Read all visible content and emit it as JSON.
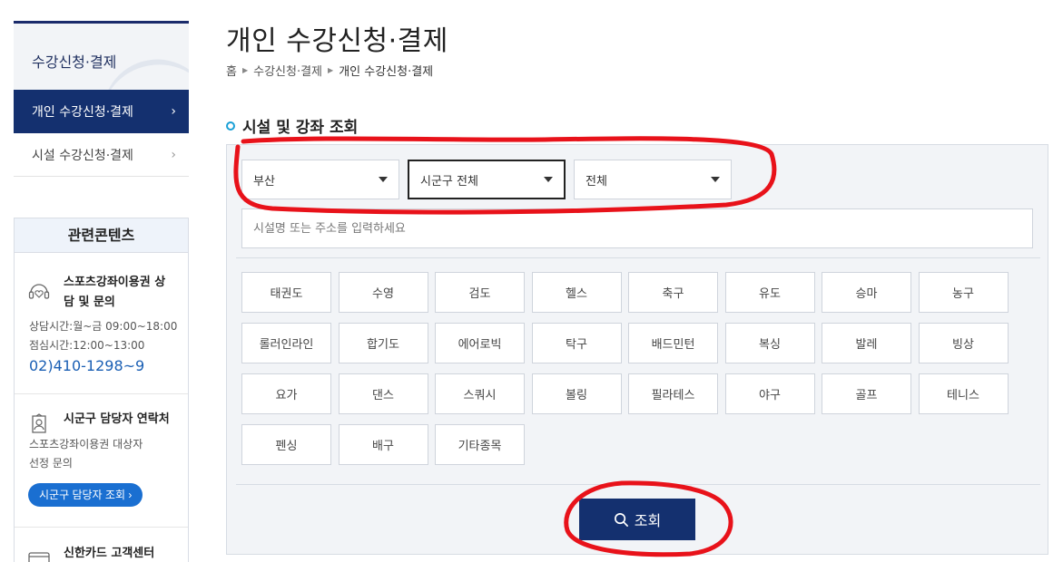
{
  "sidebar": {
    "title": "수강신청·결제",
    "items": [
      {
        "label": "개인 수강신청·결제",
        "active": true
      },
      {
        "label": "시설 수강신청·결제",
        "active": false
      }
    ]
  },
  "related": {
    "heading": "관련콘텐츠",
    "blocks": [
      {
        "icon": "headset-icon",
        "title": "스포츠강좌이용권 상담 및 문의",
        "line1": "상담시간:월~금 09:00~18:00",
        "line2": "점심시간:12:00~13:00",
        "phone": "02)410-1298~9"
      },
      {
        "icon": "person-card-icon",
        "title": "시군구 담당자 연락처",
        "line1": "스포츠강좌이용권 대상자",
        "line2": "선정 문의",
        "button": "시군구 담당자 조회 ›"
      },
      {
        "icon": "card-icon",
        "title": "신한카드 고객센터"
      }
    ]
  },
  "header": {
    "title": "개인 수강신청·결제",
    "breadcrumb": [
      "홈",
      "수강신청·결제",
      "개인 수강신청·결제"
    ]
  },
  "search": {
    "section_title": "시설 및 강좌 조회",
    "selects": [
      {
        "value": "부산"
      },
      {
        "value": "시군구 전체"
      },
      {
        "value": "전체"
      }
    ],
    "placeholder": "시설명 또는 주소를 입력하세요",
    "sports": [
      "태권도",
      "수영",
      "검도",
      "헬스",
      "축구",
      "유도",
      "승마",
      "농구",
      "롤러인라인",
      "합기도",
      "에어로빅",
      "탁구",
      "배드민턴",
      "복싱",
      "발레",
      "빙상",
      "요가",
      "댄스",
      "스쿼시",
      "볼링",
      "필라테스",
      "야구",
      "골프",
      "테니스",
      "펜싱",
      "배구",
      "기타종목"
    ],
    "button": "조회"
  },
  "colors": {
    "navy": "#14306f",
    "accent_blue": "#1a6fd1",
    "annotation_red": "#e8121a"
  }
}
